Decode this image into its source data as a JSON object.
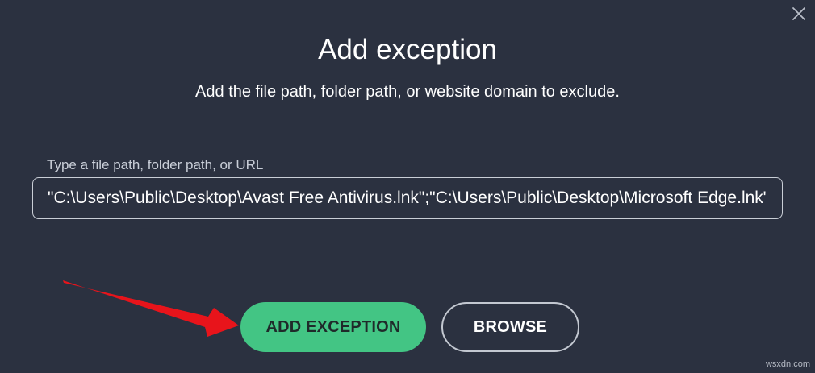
{
  "dialog": {
    "title": "Add exception",
    "subtitle": "Add the file path, folder path, or website domain to exclude.",
    "field_label": "Type a file path, folder path, or URL",
    "path_value": "\"C:\\Users\\Public\\Desktop\\Avast Free Antivirus.lnk\";\"C:\\Users\\Public\\Desktop\\Microsoft Edge.lnk\"",
    "add_button_label": "ADD EXCEPTION",
    "browse_button_label": "BROWSE"
  },
  "icons": {
    "close": "close-icon",
    "pointer": "red-arrow-pointer"
  },
  "colors": {
    "background": "#2b3140",
    "accent": "#43c584",
    "arrow": "#e8141b"
  },
  "watermark": "wsxdn.com"
}
